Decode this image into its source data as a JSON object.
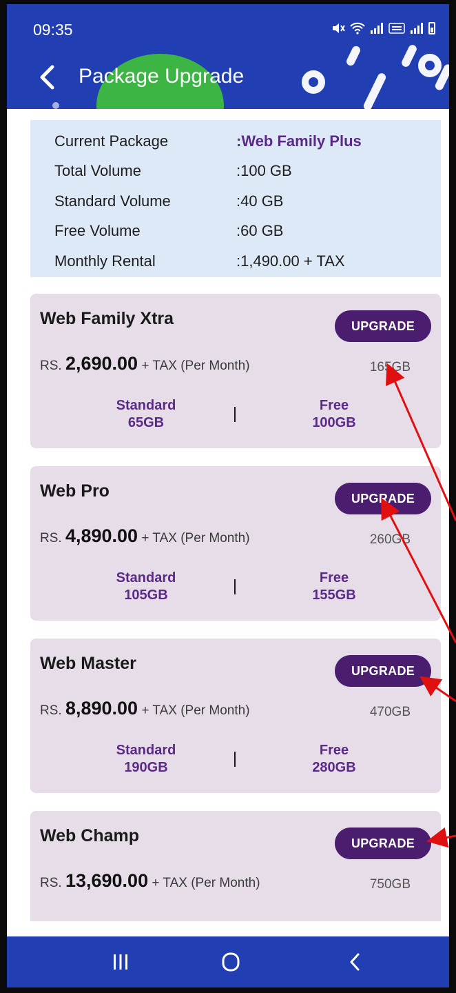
{
  "status_bar": {
    "time": "09:35"
  },
  "header": {
    "title": "Package Upgrade"
  },
  "summary": {
    "rows": [
      {
        "label": "Current Package",
        "value": ":Web Family Plus"
      },
      {
        "label": "Total Volume",
        "value": ":100 GB"
      },
      {
        "label": "Standard Volume",
        "value": ":40 GB"
      },
      {
        "label": "Free Volume",
        "value": ":60 GB"
      },
      {
        "label": "Monthly Rental",
        "value": ":1,490.00 + TAX"
      }
    ]
  },
  "packages": [
    {
      "name": "Web Family Xtra",
      "button": "UPGRADE",
      "currency": "RS.",
      "price": "2,690.00",
      "suffix": "+ TAX (Per Month)",
      "volume": "165GB",
      "standard_label": "Standard",
      "standard_value": "65GB",
      "free_label": "Free",
      "free_value": "100GB"
    },
    {
      "name": "Web Pro",
      "button": "UPGRADE",
      "currency": "RS.",
      "price": "4,890.00",
      "suffix": "+ TAX (Per Month)",
      "volume": "260GB",
      "standard_label": "Standard",
      "standard_value": "105GB",
      "free_label": "Free",
      "free_value": "155GB"
    },
    {
      "name": "Web Master",
      "button": "UPGRADE",
      "currency": "RS.",
      "price": "8,890.00",
      "suffix": "+ TAX (Per Month)",
      "volume": "470GB",
      "standard_label": "Standard",
      "standard_value": "190GB",
      "free_label": "Free",
      "free_value": "280GB"
    },
    {
      "name": "Web Champ",
      "button": "UPGRADE",
      "currency": "RS.",
      "price": "13,690.00",
      "suffix": "+ TAX (Per Month)",
      "volume": "750GB"
    }
  ],
  "colors": {
    "header": "#213fb3",
    "accent_green": "#3db545",
    "button": "#4a1d6e",
    "purple_text": "#5b2a86",
    "summary_bg": "#dde9f7",
    "card_bg": "#e6dde9",
    "annotation": "#e01010"
  },
  "icons": {
    "back": "chevron-left-icon",
    "nav_recents": "recents-icon",
    "nav_home": "home-icon",
    "nav_back": "back-icon"
  }
}
